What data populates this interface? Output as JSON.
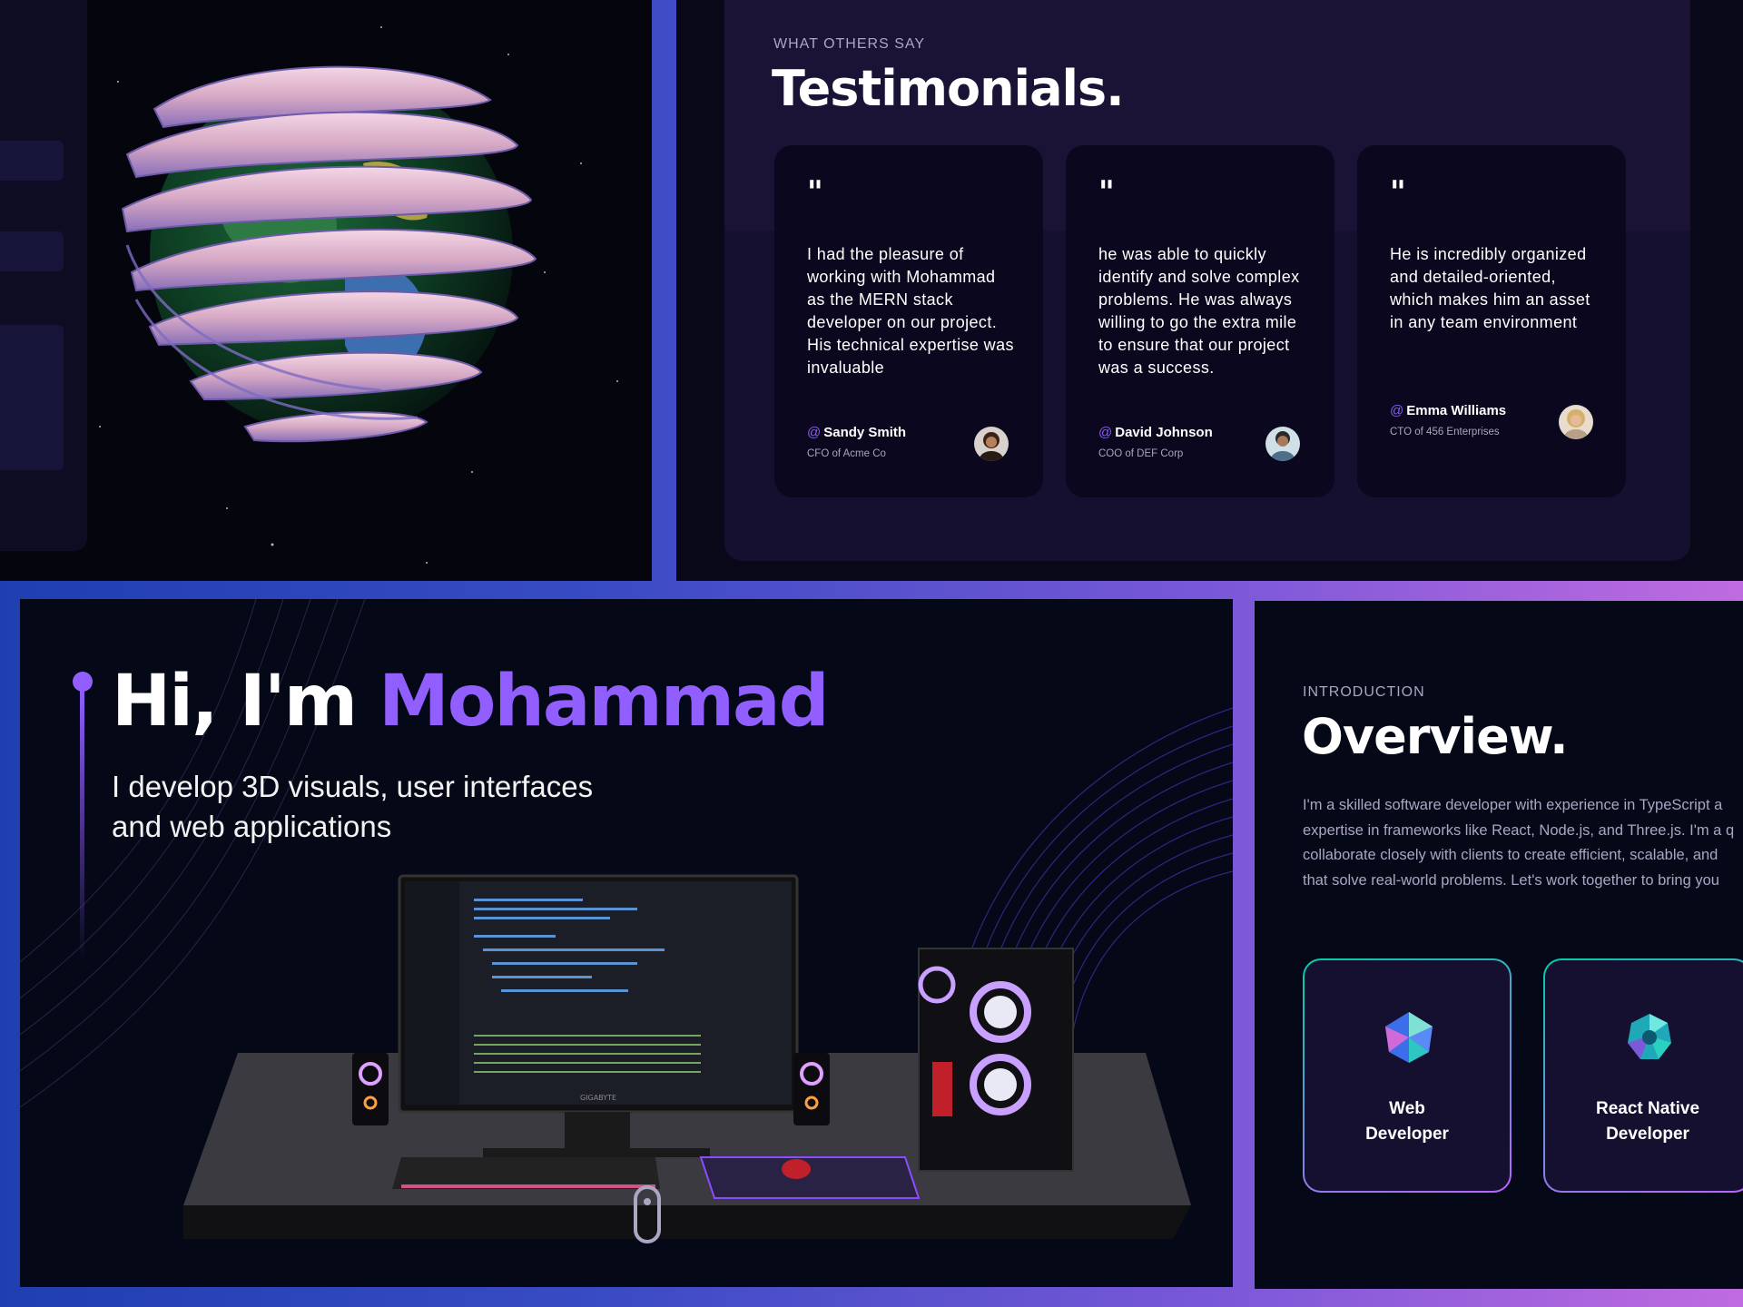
{
  "testimonials": {
    "eyebrow": "WHAT OTHERS SAY",
    "title": "Testimonials.",
    "quote_mark": "\"",
    "items": [
      {
        "text": "I had the pleasure of working with Mohammad as the MERN stack developer on our project. His technical expertise was invaluable",
        "at": "@",
        "name": "Sandy Smith",
        "role": "CFO of Acme Co"
      },
      {
        "text": "he was able to quickly identify and solve complex problems. He was always willing to go the extra mile to ensure that our project was a success.",
        "at": "@",
        "name": "David Johnson",
        "role": "COO of DEF Corp"
      },
      {
        "text": "He is incredibly organized and detailed-oriented, which makes him an asset in any team environment",
        "at": "@",
        "name": "Emma Williams",
        "role": "CTO of 456 Enterprises"
      }
    ]
  },
  "hero": {
    "greeting": "Hi, I'm ",
    "name": "Mohammad",
    "subtitle": "I develop 3D visuals, user interfaces and web applications",
    "monitor_brand": "GIGABYTE"
  },
  "overview": {
    "eyebrow": "INTRODUCTION",
    "title": "Overview.",
    "paragraph_lines": [
      "I'm a skilled software developer with experience in TypeScript a",
      "expertise in frameworks like React, Node.js, and Three.js. I'm a q",
      "collaborate closely with clients to create efficient, scalable, and",
      "that solve real-world problems. Let's work together to bring you"
    ],
    "services": [
      {
        "line1": "Web",
        "line2": "Developer"
      },
      {
        "line1": "React Native",
        "line2": "Developer"
      }
    ]
  },
  "colors": {
    "accent": "#915eff",
    "secondary_text": "#aaa6c3",
    "primary_bg": "#050816",
    "card_bg": "#151030"
  },
  "icons": [
    "globe-3d-icon",
    "avatar-icon",
    "scroll-indicator-icon",
    "web-developer-icon",
    "react-native-developer-icon"
  ]
}
